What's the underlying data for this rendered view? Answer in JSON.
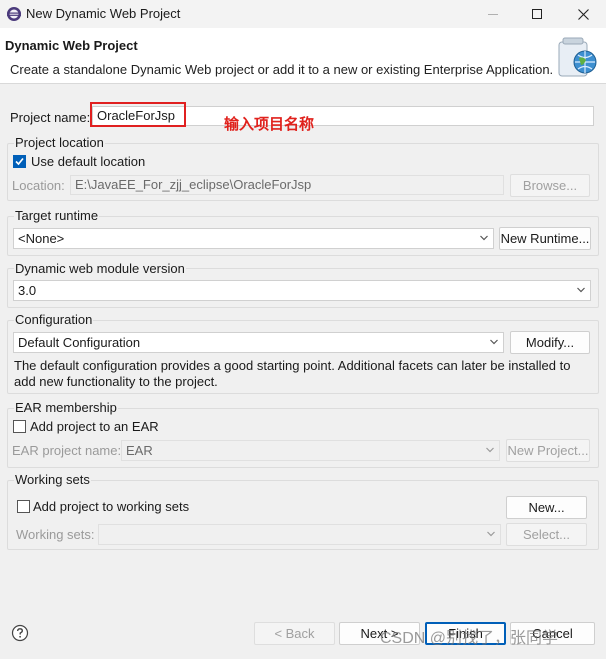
{
  "window": {
    "title": "New Dynamic Web Project"
  },
  "header": {
    "title": "Dynamic Web Project",
    "description": "Create a standalone Dynamic Web project or add it to a new or existing Enterprise Application."
  },
  "project_name": {
    "label": "Project name:",
    "value": "OracleForJsp",
    "annotation": "输入项目名称"
  },
  "project_location": {
    "group_label": "Project location",
    "use_default_label": "Use default location",
    "use_default_checked": true,
    "location_label": "Location:",
    "location_value": "E:\\JavaEE_For_zjj_eclipse\\OracleForJsp",
    "browse_label": "Browse..."
  },
  "target_runtime": {
    "group_label": "Target runtime",
    "selected": "<None>",
    "new_runtime_label": "New Runtime..."
  },
  "module_version": {
    "group_label": "Dynamic web module version",
    "selected": "3.0"
  },
  "configuration": {
    "group_label": "Configuration",
    "selected": "Default Configuration",
    "modify_label": "Modify...",
    "description_line1": "The default configuration provides a good starting point. Additional facets can later be installed to",
    "description_line2": "add new functionality to the project."
  },
  "ear": {
    "group_label": "EAR membership",
    "add_label": "Add project to an EAR",
    "add_checked": false,
    "project_name_label": "EAR project name:",
    "project_name_value": "EAR",
    "new_project_label": "New Project..."
  },
  "working_sets": {
    "group_label": "Working sets",
    "add_label": "Add project to working sets",
    "add_checked": false,
    "new_label": "New...",
    "sets_label": "Working sets:",
    "sets_value": "",
    "select_label": "Select..."
  },
  "footer": {
    "back_label": "< Back",
    "next_label": "Next >",
    "finish_label": "Finish",
    "cancel_label": "Cancel"
  },
  "watermark": "CSDN @别找了，张同学",
  "colors": {
    "accent": "#005fb8",
    "annotation_red": "#e02020",
    "background": "#f0f0f0"
  }
}
